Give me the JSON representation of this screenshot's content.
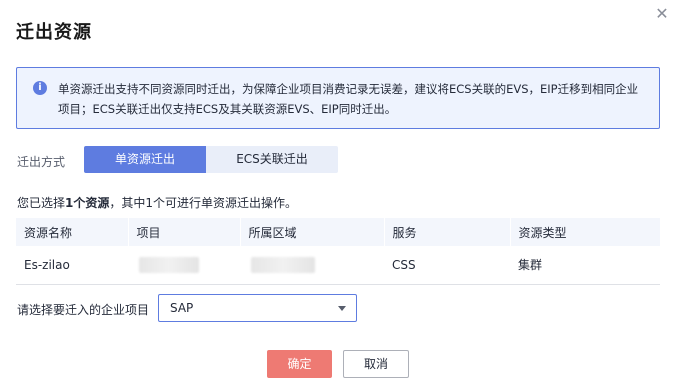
{
  "dialog": {
    "title": "迁出资源",
    "close_icon": "close-icon"
  },
  "info": {
    "icon": "info-icon",
    "text": "单资源迁出支持不同资源同时迁出，为保障企业项目消费记录无误差，建议将ECS关联的EVS，EIP迁移到相同企业项目；ECS关联迁出仅支持ECS及其关联资源EVS、EIP同时迁出。"
  },
  "mode": {
    "label": "迁出方式",
    "options": [
      "单资源迁出",
      "ECS关联迁出"
    ],
    "selected": "单资源迁出"
  },
  "summary": {
    "prefix": "您已选择",
    "count_text": "1个资源",
    "suffix": "，其中1个可进行单资源迁出操作。"
  },
  "table": {
    "headers": [
      "资源名称",
      "项目",
      "所属区域",
      "服务",
      "资源类型"
    ],
    "rows": [
      {
        "name": "Es-zilao",
        "project": "",
        "region": "",
        "service": "CSS",
        "type": "集群"
      }
    ]
  },
  "project_select": {
    "label": "请选择要迁入的企业项目",
    "value": "SAP"
  },
  "footer": {
    "ok_label": "确定",
    "cancel_label": "取消"
  },
  "colors": {
    "primary": "#5e7ce0",
    "ok_button": "#ee7a73",
    "info_bg": "#eef3fe"
  }
}
